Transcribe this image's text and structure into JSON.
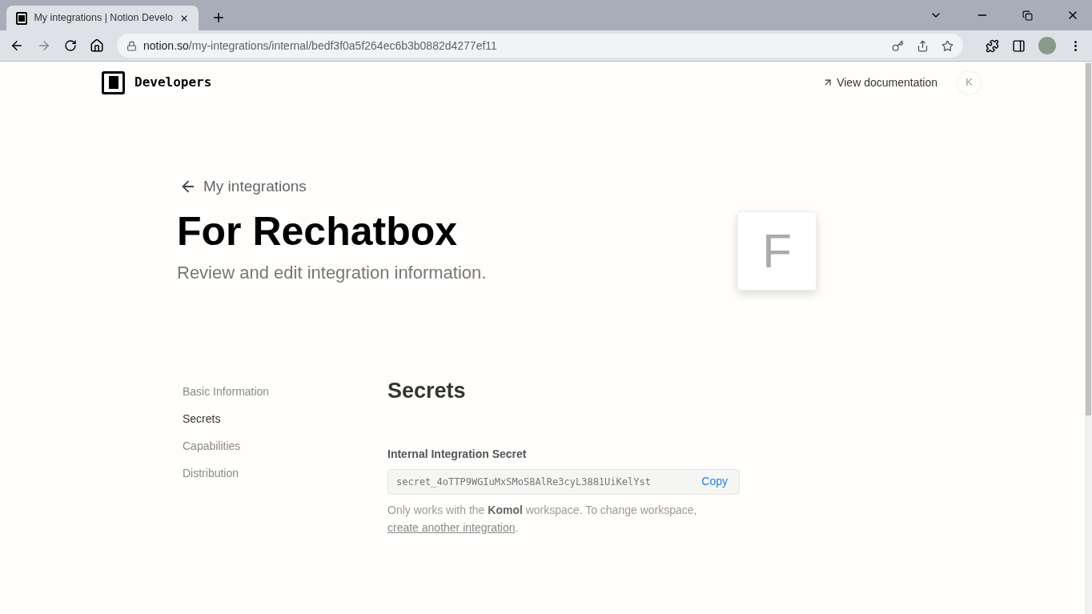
{
  "browser": {
    "tab_title": "My integrations | Notion Develo",
    "url_host": "notion.so",
    "url_path": "/my-integrations/internal/bedf3f0a5f264ec6b3b0882d4277ef11"
  },
  "header": {
    "brand": "Developers",
    "docs_link": "View documentation",
    "avatar_letter": "K"
  },
  "back_link": "My integrations",
  "title": "For Rechatbox",
  "subtitle": "Review and edit integration information.",
  "icon_letter": "F",
  "sidebar": {
    "items": [
      {
        "label": "Basic Information",
        "selected": false
      },
      {
        "label": "Secrets",
        "selected": true
      },
      {
        "label": "Capabilities",
        "selected": false
      },
      {
        "label": "Distribution",
        "selected": false
      }
    ]
  },
  "section": {
    "heading": "Secrets",
    "field_label": "Internal Integration Secret",
    "secret_value": "secret_4oTTP9WGIuMxSMoS8AlRe3cyL3881UiKelYst",
    "copy_button": "Copy",
    "note": "Only works with the **Komol** workspace. To change workspace,",
    "note_link": "create another integration",
    "note_end": "."
  }
}
